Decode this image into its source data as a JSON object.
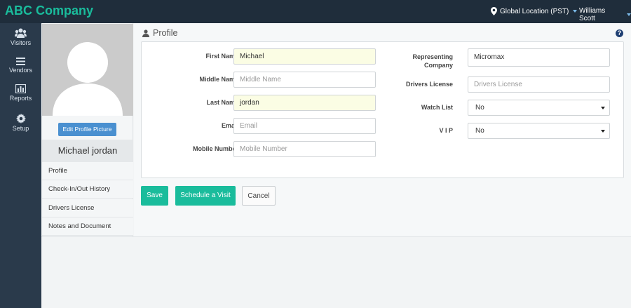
{
  "app": {
    "brand": "ABC Company"
  },
  "topbar": {
    "location": "Global Location (PST)",
    "user": "Williams Scott"
  },
  "nav": [
    {
      "label": "Visitors",
      "icon": "users-icon"
    },
    {
      "label": "Vendors",
      "icon": "list-icon"
    },
    {
      "label": "Reports",
      "icon": "bar-chart-icon"
    },
    {
      "label": "Setup",
      "icon": "gear-icon"
    }
  ],
  "profile_panel": {
    "edit_picture_label": "Edit Profile Picture",
    "name": "Michael jordan",
    "menu": [
      "Profile",
      "Check-In/Out History",
      "Drivers License",
      "Notes and Document"
    ]
  },
  "main": {
    "title": "Profile"
  },
  "form": {
    "first_name": {
      "label": "First Name",
      "value": "Michael"
    },
    "middle_name": {
      "label": "Middle Name",
      "placeholder": "Middle Name"
    },
    "last_name": {
      "label": "Last Name",
      "value": "jordan"
    },
    "email": {
      "label": "Email",
      "placeholder": "Email"
    },
    "mobile": {
      "label": "Mobile Number",
      "placeholder": "Mobile Number"
    },
    "representing_company": {
      "label_line1": "Representing",
      "label_line2": "Company",
      "value": "Micromax"
    },
    "drivers_license": {
      "label": "Drivers License",
      "placeholder": "Drivers License"
    },
    "watch_list": {
      "label": "Watch List",
      "value": "No"
    },
    "vip": {
      "label": "V I P",
      "value": "No"
    }
  },
  "actions": {
    "save": "Save",
    "schedule": "Schedule a Visit",
    "cancel": "Cancel"
  },
  "colors": {
    "accent": "#1abc9c",
    "topbar": "#1f2d3b",
    "sidebar": "#2a3a4b",
    "button_blue": "#4a90d0"
  }
}
